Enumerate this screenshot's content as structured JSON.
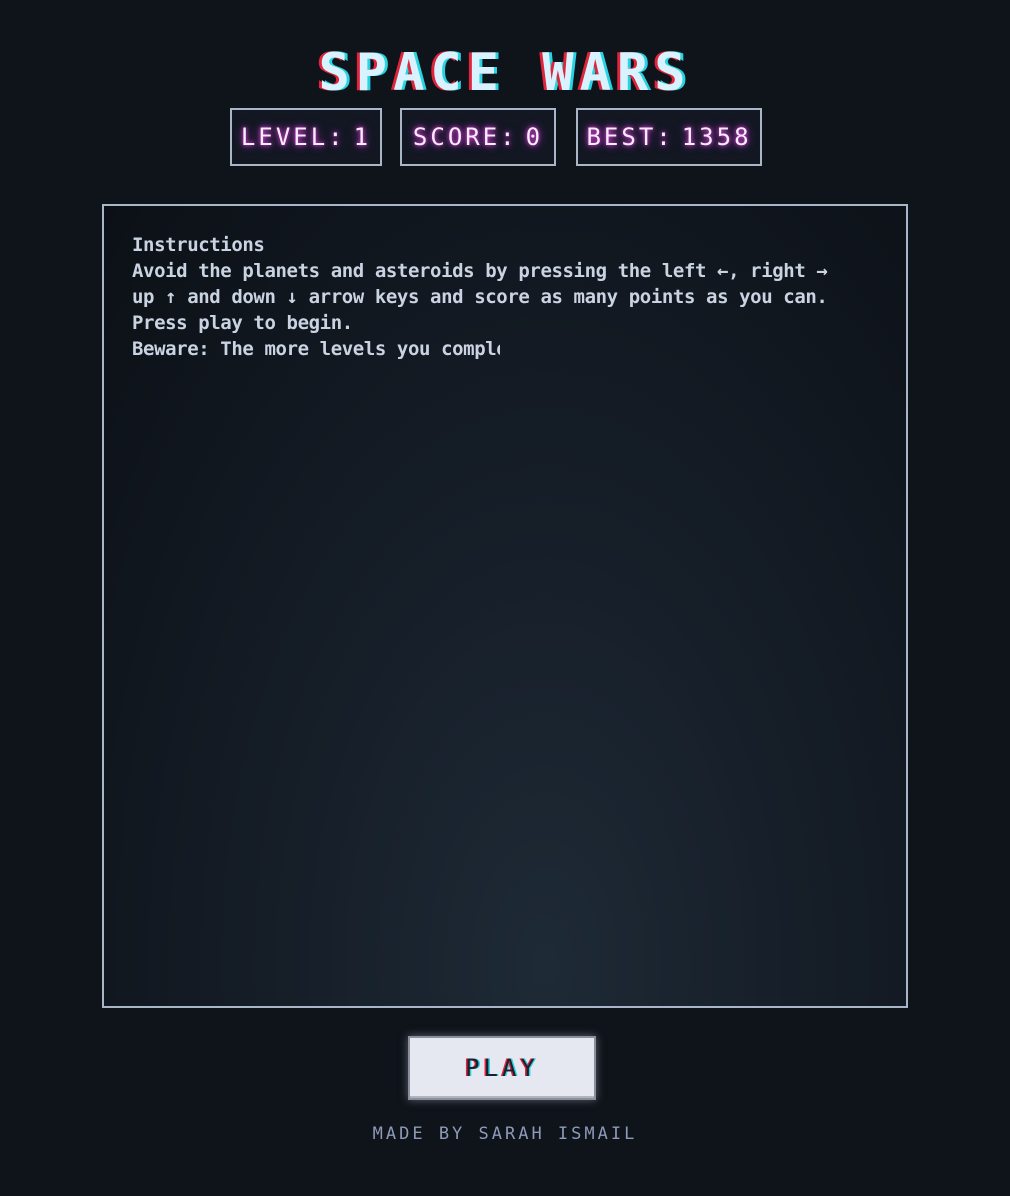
{
  "title": "SPACE WARS",
  "stats": {
    "level_label": "LEVEL:",
    "level_value": "1",
    "score_label": "SCORE:",
    "score_value": "0",
    "best_label": "BEST:",
    "best_value": "1358"
  },
  "instructions": {
    "heading": "Instructions",
    "line1": "Avoid the planets and asteroids by pressing the left ←, right →",
    "line2": "up ↑ and down ↓ arrow keys and score as many points as you can.",
    "line3": "Press play to begin.",
    "line4": "Beware: The more levels you complet"
  },
  "play_label": "PLAY",
  "credit": "MADE BY SARAH ISMAIL",
  "colors": {
    "background": "#0f131a",
    "title_red": "#e0243c",
    "title_cyan": "#2ad3e2",
    "stat_glow": "#e34bd6",
    "border": "#a9b6c8",
    "button_bg": "#e6e8f1"
  }
}
